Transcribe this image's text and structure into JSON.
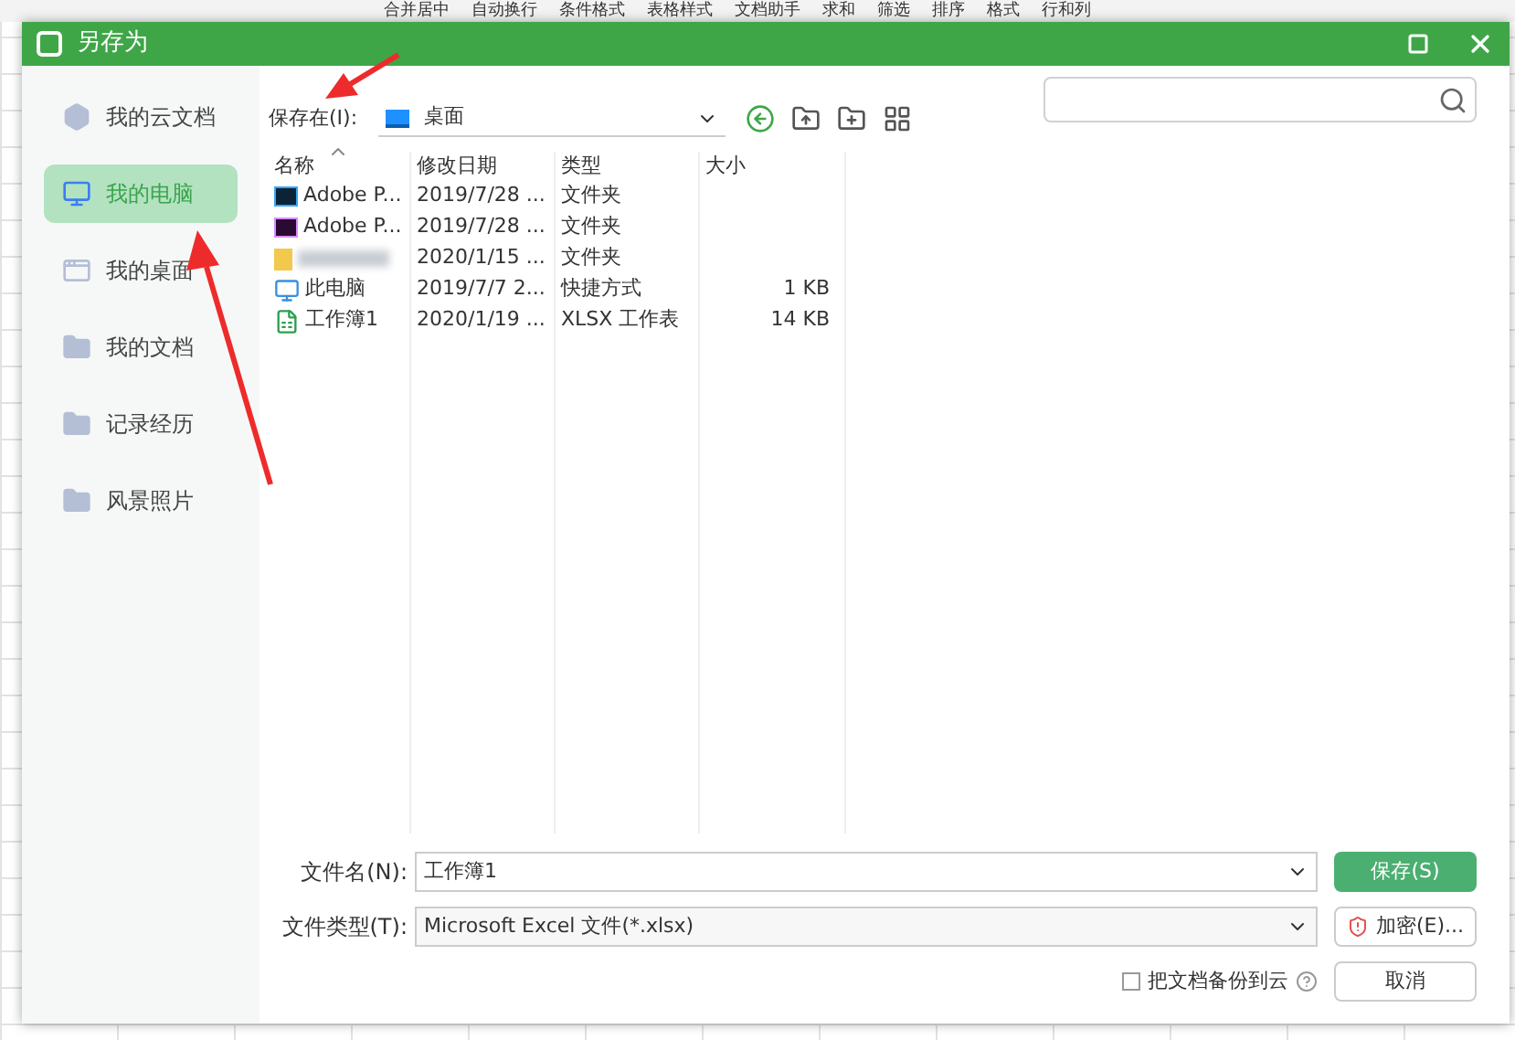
{
  "toolbar": [
    "合并居中",
    "自动换行",
    "条件格式",
    "表格样式",
    "文档助手",
    "求和",
    "筛选",
    "排序",
    "格式",
    "行和列"
  ],
  "window": {
    "title": "另存为"
  },
  "sidebar": {
    "items": [
      {
        "label": "我的云文档",
        "kind": "cloud",
        "selected": false
      },
      {
        "label": "我的电脑",
        "kind": "computer",
        "selected": true
      },
      {
        "label": "我的桌面",
        "kind": "desktop",
        "selected": false
      },
      {
        "label": "我的文档",
        "kind": "folder",
        "selected": false
      },
      {
        "label": "记录经历",
        "kind": "folder",
        "selected": false
      },
      {
        "label": "风景照片",
        "kind": "folder",
        "selected": false
      }
    ]
  },
  "location": {
    "label": "保存在(I):",
    "value": "桌面"
  },
  "table": {
    "columns": [
      "名称",
      "修改日期",
      "类型",
      "大小"
    ],
    "rows": [
      {
        "kind": "ps",
        "name": "Adobe P...",
        "date": "2019/7/28 ...",
        "type": "文件夹"
      },
      {
        "kind": "pr",
        "name": "Adobe P...",
        "date": "2019/7/28 ...",
        "type": "文件夹"
      },
      {
        "kind": "blurred",
        "date": "2020/1/15 ...",
        "type": "文件夹"
      },
      {
        "kind": "shortcut",
        "name": "此电脑",
        "date": "2019/7/7 2...",
        "type": "快捷方式",
        "size": "1 KB"
      },
      {
        "kind": "xlsx",
        "name": "工作簿1",
        "date": "2020/1/19 ...",
        "type": "XLSX 工作表",
        "size": "14 KB"
      }
    ]
  },
  "filename": {
    "label": "文件名(N):",
    "value": "工作簿1"
  },
  "filetype": {
    "label": "文件类型(T):",
    "value": "Microsoft Excel 文件(*.xlsx)"
  },
  "backup": {
    "label": "把文档备份到云",
    "checked": false
  },
  "buttons": {
    "save": "保存(S)",
    "encrypt": "加密(E)...",
    "cancel": "取消"
  }
}
